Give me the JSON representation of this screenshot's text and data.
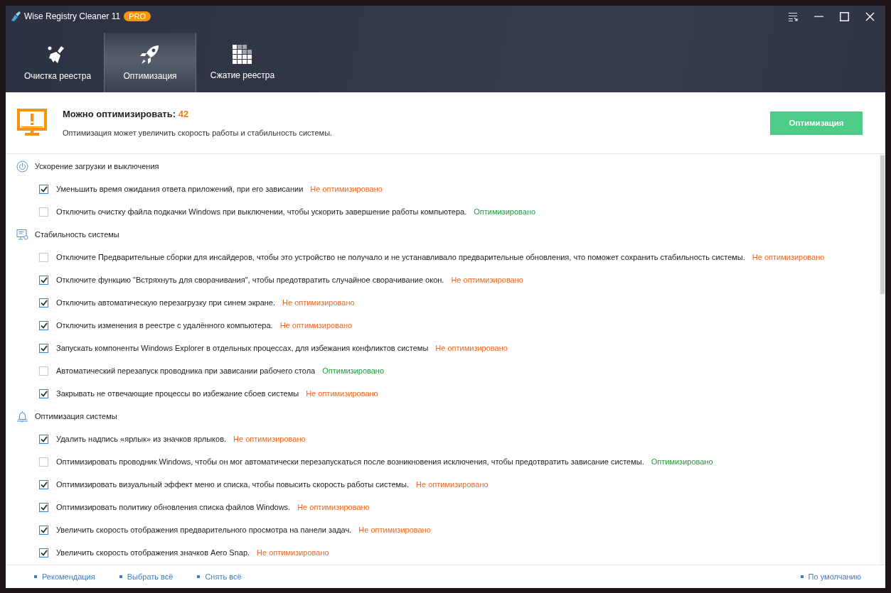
{
  "window": {
    "title": "Wise Registry Cleaner 11",
    "badge": "PRO"
  },
  "tabs": [
    {
      "label": "Очистка реестра",
      "kind": "broom",
      "selected": false
    },
    {
      "label": "Оптимизация",
      "kind": "rocket",
      "selected": true
    },
    {
      "label": "Сжатие реестра",
      "kind": "blocks",
      "selected": false
    }
  ],
  "summary": {
    "title": "Можно оптимизировать:",
    "count": "42",
    "description": "Оптимизация может увеличить скорость работы и стабильность системы.",
    "button": "Оптимизация"
  },
  "sections": [
    {
      "title": "Ускорение загрузки и выключения",
      "kind": "power",
      "items": [
        {
          "label": "Уменьшить время ожидания ответа приложений, при его зависании",
          "checked": true,
          "status": "Не оптимизировано",
          "optimized": false
        },
        {
          "label": "Отключить очистку файла подкачки Windows при выключении, чтобы ускорить завершение работы компьютера.",
          "checked": false,
          "status": "Оптимизировано",
          "optimized": true
        }
      ]
    },
    {
      "title": "Стабильность системы",
      "kind": "monitor",
      "items": [
        {
          "label": "Отключите Предварительные сборки для инсайдеров, чтобы это устройство не получало и не устанавливало предварительные обновления, что поможет сохранить стабильность системы.",
          "checked": false,
          "status": "Не оптимизировано",
          "optimized": false
        },
        {
          "label": "Отключите функцию \"Встряхнуть для сворачивания\", чтобы предотвратить случайное сворачивание окон.",
          "checked": true,
          "status": "Не оптимизировано",
          "optimized": false
        },
        {
          "label": "Отключить автоматическую перезагрузку при синем экране.",
          "checked": true,
          "status": "Не оптимизировано",
          "optimized": false
        },
        {
          "label": "Отключить изменения в реестре с удалённого компьютера.",
          "checked": true,
          "status": "Не оптимизировано",
          "optimized": false
        },
        {
          "label": "Запускать компоненты Windows Explorer в отдельных процессах, для избежания конфликтов системы",
          "checked": true,
          "status": "Не оптимизировано",
          "optimized": false
        },
        {
          "label": "Автоматический перезапуск проводника при зависании рабочего стола",
          "checked": false,
          "status": "Оптимизировано",
          "optimized": true
        },
        {
          "label": "Закрывать не отвечающие процессы во избежание сбоев системы",
          "checked": true,
          "status": "Не оптимизировано",
          "optimized": false
        }
      ]
    },
    {
      "title": "Оптимизация системы",
      "kind": "bell",
      "items": [
        {
          "label": "Удалить надпись «ярлык» из значков ярлыков.",
          "checked": true,
          "status": "Не оптимизировано",
          "optimized": false
        },
        {
          "label": "Оптимизировать проводник Windows, чтобы он мог автоматически перезапускаться после возникновения исключения, чтобы предотвратить зависание системы.",
          "checked": false,
          "status": "Оптимизировано",
          "optimized": true
        },
        {
          "label": "Оптимизировать визуальный эффект меню и списка, чтобы повысить скорость работы системы.",
          "checked": true,
          "status": "Не оптимизировано",
          "optimized": false
        },
        {
          "label": "Оптимизировать политику обновления списка файлов Windows.",
          "checked": true,
          "status": "Не оптимизировано",
          "optimized": false
        },
        {
          "label": "Увеличить скорость отображения предварительного просмотра на панели задач.",
          "checked": true,
          "status": "Не оптимизировано",
          "optimized": false
        },
        {
          "label": "Увеличить скорость отображения значков Aero Snap.",
          "checked": true,
          "status": "Не оптимизировано",
          "optimized": false
        }
      ]
    }
  ],
  "footer_links": [
    "Рекомендация",
    "Выбрать всё",
    "Снять всё"
  ],
  "footer_right": "По умолчанию"
}
